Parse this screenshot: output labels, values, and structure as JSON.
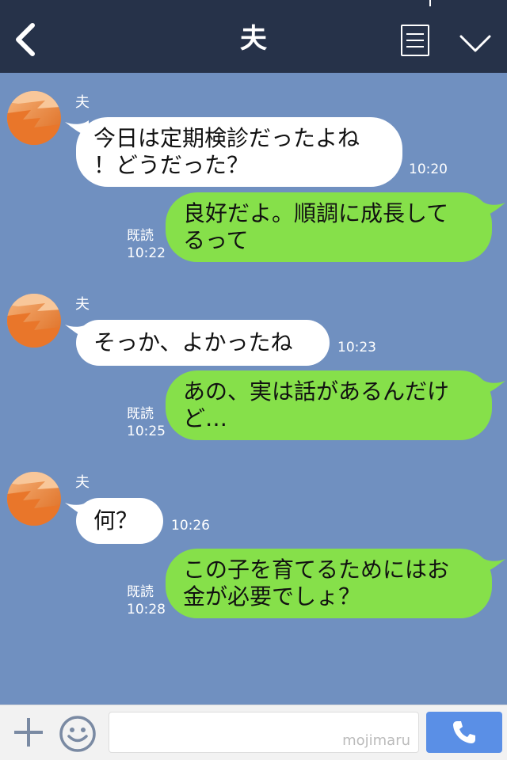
{
  "header": {
    "title": "夫"
  },
  "messages": [
    {
      "side": "in",
      "sender": "夫",
      "text": "今日は定期検診だったよね\n！どうだった？",
      "time": "10:20"
    },
    {
      "side": "out",
      "read": "既読",
      "text": "良好だよ。順調に成長して\nるって",
      "time": "10:22"
    },
    {
      "side": "in",
      "sender": "夫",
      "text": "そっか、よかったね",
      "time": "10:23"
    },
    {
      "side": "out",
      "read": "既読",
      "text": "あの、実は話があるんだけ\nど…",
      "time": "10:25"
    },
    {
      "side": "in",
      "sender": "夫",
      "text": "何？",
      "time": "10:26"
    },
    {
      "side": "out",
      "read": "既読",
      "text": "この子を育てるためにはお\n金が必要でしょ？",
      "time": "10:28"
    }
  ],
  "footer": {
    "input_value": "",
    "watermark": "mojimaru"
  },
  "colors": {
    "header_bg": "#263249",
    "chat_bg": "#7090c0",
    "incoming_bubble": "#ffffff",
    "outgoing_bubble": "#86e04a",
    "call_button": "#5a8fe6"
  }
}
